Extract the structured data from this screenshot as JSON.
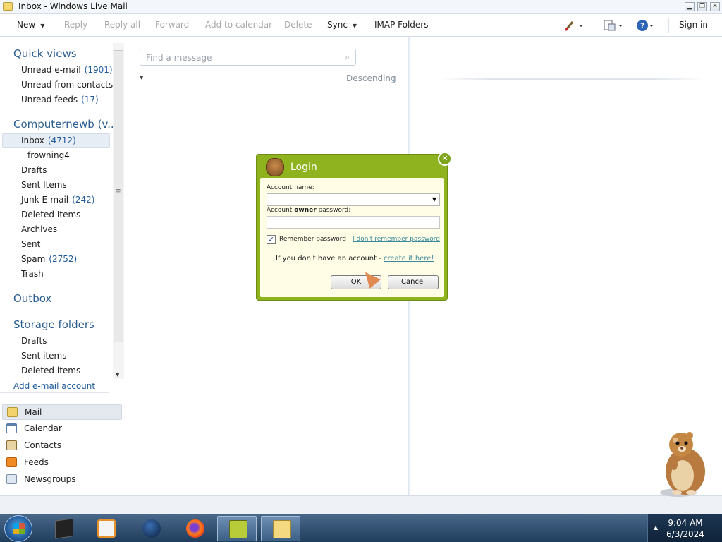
{
  "window": {
    "title": "Inbox - Windows Live Mail"
  },
  "toolbar": {
    "new": "New",
    "reply": "Reply",
    "reply_all": "Reply all",
    "forward": "Forward",
    "add_to_calendar": "Add to calendar",
    "delete": "Delete",
    "sync": "Sync",
    "imap_folders": "IMAP Folders",
    "sign_in": "Sign in"
  },
  "nav": {
    "quick_views_title": "Quick views",
    "quick_views": [
      {
        "label": "Unread e-mail",
        "count": "(1901)"
      },
      {
        "label": "Unread from contacts",
        "count": ""
      },
      {
        "label": "Unread feeds",
        "count": "(17)"
      }
    ],
    "account_title": "Computernewb (v...",
    "folders": [
      {
        "label": "Inbox",
        "count": "(4712)"
      },
      {
        "label": "frowning4",
        "count": ""
      },
      {
        "label": "Drafts",
        "count": ""
      },
      {
        "label": "Sent Items",
        "count": ""
      },
      {
        "label": "Junk E-mail",
        "count": "(242)"
      },
      {
        "label": "Deleted Items",
        "count": ""
      },
      {
        "label": "Archives",
        "count": ""
      },
      {
        "label": "Sent",
        "count": ""
      },
      {
        "label": "Spam",
        "count": "(2752)"
      },
      {
        "label": "Trash",
        "count": ""
      }
    ],
    "outbox_title": "Outbox",
    "storage_title": "Storage folders",
    "storage_folders": [
      {
        "label": "Drafts"
      },
      {
        "label": "Sent items"
      },
      {
        "label": "Deleted items"
      }
    ],
    "add_account": "Add e-mail account",
    "modules": [
      {
        "label": "Mail"
      },
      {
        "label": "Calendar"
      },
      {
        "label": "Contacts"
      },
      {
        "label": "Feeds"
      },
      {
        "label": "Newsgroups"
      }
    ]
  },
  "list": {
    "search_placeholder": "Find a message",
    "sort_label": "Descending"
  },
  "login": {
    "title": "Login",
    "account_label": "Account name:",
    "password_label_prefix": "Account ",
    "password_label_bold": "owner",
    "password_label_suffix": " password:",
    "account_value": "",
    "password_value": "",
    "remember_label": "Remember password",
    "remember_checked": true,
    "forgot_link": "I don't remember password",
    "no_account_text": "If you don't have an account - ",
    "create_link": "create it here!",
    "ok_label": "OK",
    "cancel_label": "Cancel"
  },
  "taskbar": {
    "time": "9:04 AM",
    "date": "6/3/2024"
  },
  "colors": {
    "dialog_green": "#8fb31e",
    "dialog_body": "#fffde6",
    "link_teal": "#3a8a9c",
    "nav_heading_blue": "#2a5d8f"
  }
}
